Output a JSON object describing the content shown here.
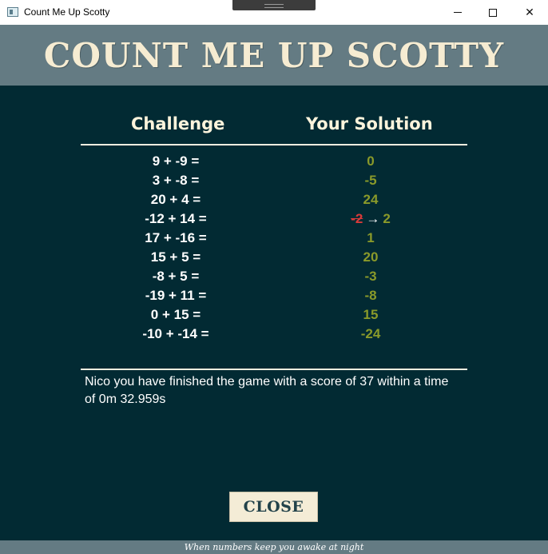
{
  "window": {
    "title": "Count Me Up Scotty",
    "icons": {
      "app": "app-window-icon",
      "minimize": "minimize-icon",
      "maximize": "maximize-icon",
      "close": "close-icon"
    }
  },
  "header": {
    "title": "COUNT ME UP SCOTTY"
  },
  "table": {
    "col_challenge": "Challenge",
    "col_solution": "Your Solution",
    "rows": [
      {
        "challenge": "9 + -9 =",
        "solution": "0"
      },
      {
        "challenge": "3 + -8 =",
        "solution": "-5"
      },
      {
        "challenge": "20 + 4 =",
        "solution": "24"
      },
      {
        "challenge": "-12 + 14 =",
        "wrong_answer": "-2",
        "arrow": "→",
        "correct_answer": "2"
      },
      {
        "challenge": "17 + -16 =",
        "solution": "1"
      },
      {
        "challenge": "15 + 5 =",
        "solution": "20"
      },
      {
        "challenge": "-8 + 5 =",
        "solution": "-3"
      },
      {
        "challenge": "-19 + 11 =",
        "solution": "-8"
      },
      {
        "challenge": "0 + 15 =",
        "solution": "15"
      },
      {
        "challenge": "-10 + -14 =",
        "solution": "-24"
      }
    ]
  },
  "result": {
    "message": "Nico you have finished the game with a score of 37 within a time of 0m 32.959s"
  },
  "close_button": {
    "label": "CLOSE"
  },
  "footer": {
    "tagline": "When numbers keep you awake at night"
  },
  "colors": {
    "background": "#022a33",
    "header_band": "#647b83",
    "title_text": "#f6ecd2",
    "correct": "#8a9a2a",
    "wrong": "#d93a3a"
  }
}
